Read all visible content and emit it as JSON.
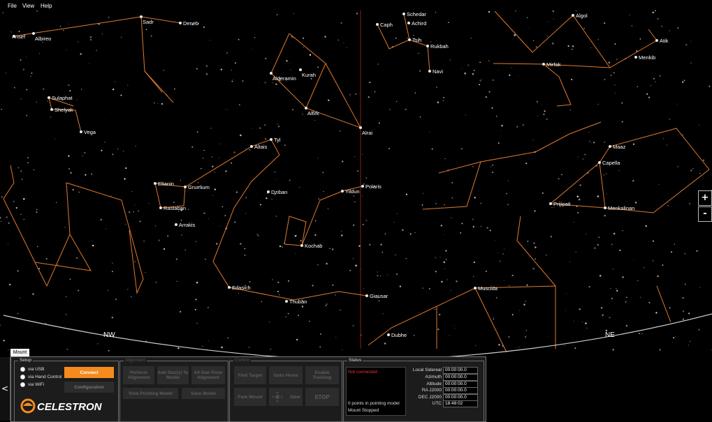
{
  "menu": {
    "file": "File",
    "view": "View",
    "help": "Help"
  },
  "sky": {
    "compass": {
      "nw": "NW",
      "ne": "NE"
    },
    "stars": [
      {
        "id": "ansef",
        "label": "Ansef"
      },
      {
        "id": "albireo",
        "label": "Albireo"
      },
      {
        "id": "sadr",
        "label": "Sadr"
      },
      {
        "id": "deneb",
        "label": "Deneb"
      },
      {
        "id": "sulaphat",
        "label": "Sulaphat"
      },
      {
        "id": "shelyak",
        "label": "Shelyak"
      },
      {
        "id": "vega",
        "label": "Vega"
      },
      {
        "id": "alderamin",
        "label": "Alderamin"
      },
      {
        "id": "kurah",
        "label": "Kurah"
      },
      {
        "id": "alfirk",
        "label": "Alfirk"
      },
      {
        "id": "alrai",
        "label": "Alrai"
      },
      {
        "id": "caph",
        "label": "Caph"
      },
      {
        "id": "schedar",
        "label": "Schedar"
      },
      {
        "id": "achird",
        "label": "Achird"
      },
      {
        "id": "tsih",
        "label": "Tsih"
      },
      {
        "id": "rukbah",
        "label": "Rukbah"
      },
      {
        "id": "navi",
        "label": "Navi"
      },
      {
        "id": "algol",
        "label": "Algol"
      },
      {
        "id": "atik",
        "label": "Atik"
      },
      {
        "id": "menkib",
        "label": "Menkib"
      },
      {
        "id": "mirfak",
        "label": "Mirfak"
      },
      {
        "id": "tyl",
        "label": "Tyl"
      },
      {
        "id": "altais",
        "label": "Altais"
      },
      {
        "id": "eltanin",
        "label": "Eltanin"
      },
      {
        "id": "grumium",
        "label": "Grumium"
      },
      {
        "id": "rastaban",
        "label": "Rastaban"
      },
      {
        "id": "arrakis",
        "label": "Arrakis"
      },
      {
        "id": "dziban",
        "label": "Dziban"
      },
      {
        "id": "yildun",
        "label": "Yildun"
      },
      {
        "id": "polaris",
        "label": "Polaris"
      },
      {
        "id": "kochab",
        "label": "Kochab"
      },
      {
        "id": "edasich",
        "label": "Edasich"
      },
      {
        "id": "thuban",
        "label": "Thuban"
      },
      {
        "id": "giausar",
        "label": "Giausar"
      },
      {
        "id": "muscida",
        "label": "Muscida"
      },
      {
        "id": "dubhe",
        "label": "Dubhe"
      },
      {
        "id": "maaz",
        "label": "Maaz"
      },
      {
        "id": "capella",
        "label": "Capella"
      },
      {
        "id": "prijipati",
        "label": "Prijipati"
      },
      {
        "id": "menkalinan",
        "label": "Menkalinan"
      }
    ],
    "colors": {
      "lines": "#e07a2e",
      "background": "#000000",
      "horizon": "#cfcfcf",
      "meridian": "#8b1d1d"
    }
  },
  "zoom": {
    "in": "+",
    "out": "-"
  },
  "panel": {
    "tab": "Mount",
    "collapse": "<",
    "setup": {
      "title": "Setup",
      "options": [
        {
          "label": "via USB",
          "selected": false
        },
        {
          "label": "via Hand Control",
          "selected": false
        },
        {
          "label": "via WiFi",
          "selected": false
        }
      ],
      "connect": "Connect",
      "configuration": "Configuration",
      "brand": "CELESTRON"
    },
    "alignment": {
      "title": "Alignment",
      "perform": "Perform Alignment",
      "add_stars": "Add Star(s) To Model",
      "all_star": "All-Star Polar Alignment",
      "view_model": "View Pointing Model",
      "save_model": "Save Model"
    },
    "control": {
      "title": "Control",
      "find_target": "Find Target",
      "goto_home": "Goto Home",
      "enable_tracking": "Enable Tracking",
      "park_mount": "Park Mount",
      "slew": "Slew",
      "stop": "STOP"
    },
    "status": {
      "title": "Status",
      "connection": "Not connected",
      "points": "0 points in pointing model",
      "mount_state": "Mount Stopped",
      "fields": [
        {
          "label": "Local Sidereal",
          "value": "00:00:00.0"
        },
        {
          "label": "Azimuth",
          "value": "00:00:00.0"
        },
        {
          "label": "Altitude",
          "value": "00:00:00.0"
        },
        {
          "label": "RA J2000",
          "value": "00:00:00.0"
        },
        {
          "label": "DEC J2000",
          "value": "00:00:00.0"
        },
        {
          "label": "UTC",
          "value": "18:48:02"
        }
      ]
    },
    "colors": {
      "accent": "#f58a1f",
      "alert": "#e33333"
    }
  }
}
